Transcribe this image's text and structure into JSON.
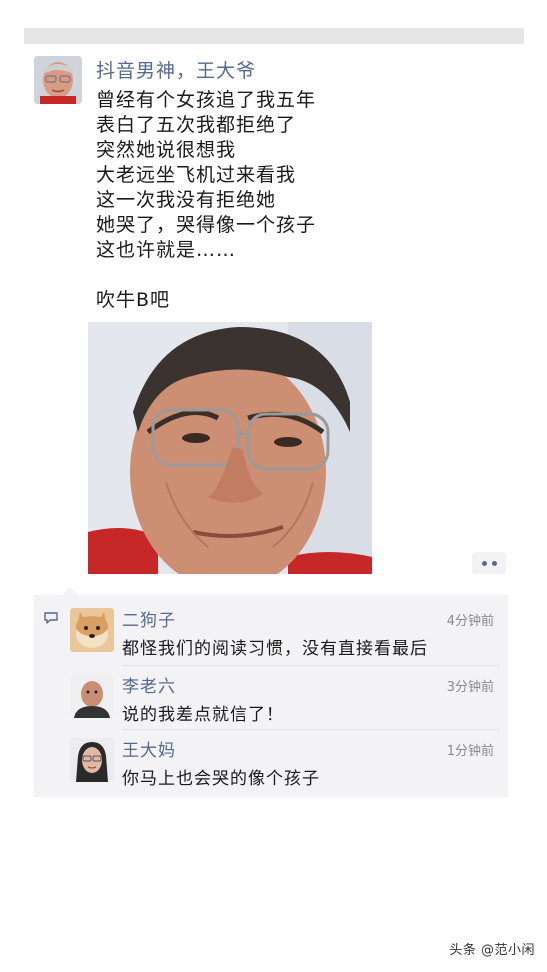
{
  "post": {
    "author": "抖音男神，王大爷",
    "lines": [
      "曾经有个女孩追了我五年",
      "表白了五次我都拒绝了",
      "突然她说很想我",
      "大老远坐飞机过来看我",
      "这一次我没有拒绝她",
      "她哭了，哭得像一个孩子",
      "这也许就是……"
    ],
    "punchline": "吹牛B吧"
  },
  "comments": [
    {
      "name": "二狗子",
      "time": "4分钟前",
      "text": "都怪我们的阅读习惯，没有直接看最后"
    },
    {
      "name": "李老六",
      "time": "3分钟前",
      "text": "说的我差点就信了！"
    },
    {
      "name": "王大妈",
      "time": "1分钟前",
      "text": "你马上也会哭的像个孩子"
    }
  ],
  "watermark": "头条 @范小闲",
  "colors": {
    "name_link": "#56698f",
    "comment_bg": "#f3f3f5"
  },
  "icons": [
    "comment-icon",
    "more-options-icon"
  ]
}
